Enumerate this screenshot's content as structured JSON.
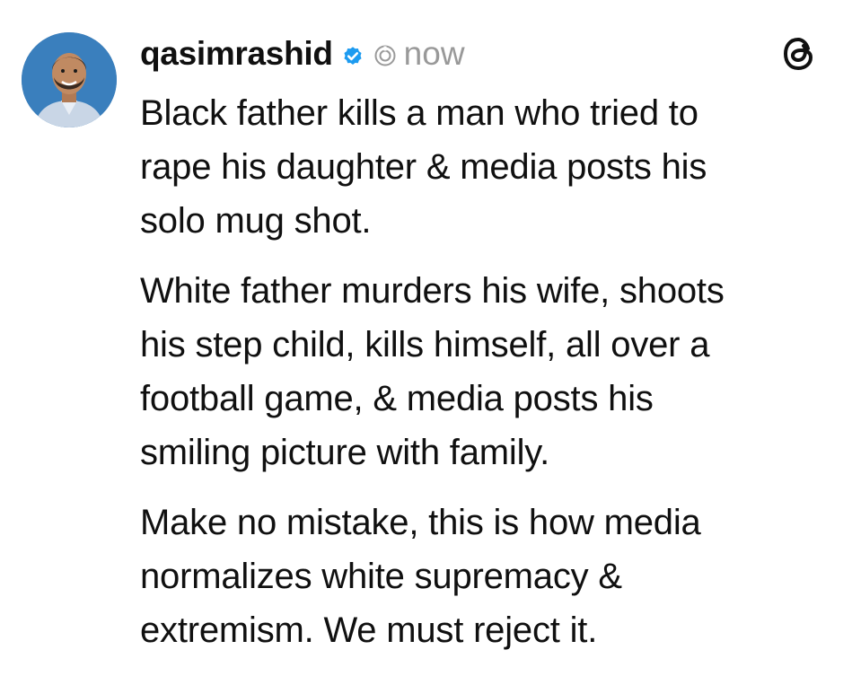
{
  "post": {
    "author": {
      "username": "qasimrashid",
      "verified": true,
      "verified_color": "#1D9BF0",
      "avatar_background": "#2f6fa8"
    },
    "time": "now",
    "icons": {
      "verified": "verified-badge-icon",
      "source": "threads-source-icon",
      "app_logo": "threads-logo-icon"
    },
    "paragraphs": [
      "Black father kills a man who tried to\nrape his daughter & media posts his\nsolo mug shot.",
      "White father murders his wife, shoots\nhis step child, kills himself, all over a\nfootball game, & media posts his\nsmiling picture with family.",
      "Make no mistake, this is how media\nnormalizes white supremacy &\nextremism. We must reject it."
    ]
  }
}
